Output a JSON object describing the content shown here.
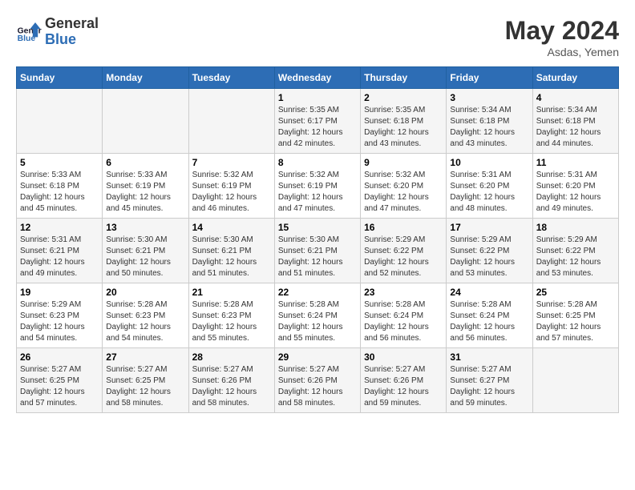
{
  "header": {
    "logo_line1": "General",
    "logo_line2": "Blue",
    "month_year": "May 2024",
    "location": "Asdas, Yemen"
  },
  "weekdays": [
    "Sunday",
    "Monday",
    "Tuesday",
    "Wednesday",
    "Thursday",
    "Friday",
    "Saturday"
  ],
  "weeks": [
    [
      {
        "day": "",
        "info": ""
      },
      {
        "day": "",
        "info": ""
      },
      {
        "day": "",
        "info": ""
      },
      {
        "day": "1",
        "info": "Sunrise: 5:35 AM\nSunset: 6:17 PM\nDaylight: 12 hours\nand 42 minutes."
      },
      {
        "day": "2",
        "info": "Sunrise: 5:35 AM\nSunset: 6:18 PM\nDaylight: 12 hours\nand 43 minutes."
      },
      {
        "day": "3",
        "info": "Sunrise: 5:34 AM\nSunset: 6:18 PM\nDaylight: 12 hours\nand 43 minutes."
      },
      {
        "day": "4",
        "info": "Sunrise: 5:34 AM\nSunset: 6:18 PM\nDaylight: 12 hours\nand 44 minutes."
      }
    ],
    [
      {
        "day": "5",
        "info": "Sunrise: 5:33 AM\nSunset: 6:18 PM\nDaylight: 12 hours\nand 45 minutes."
      },
      {
        "day": "6",
        "info": "Sunrise: 5:33 AM\nSunset: 6:19 PM\nDaylight: 12 hours\nand 45 minutes."
      },
      {
        "day": "7",
        "info": "Sunrise: 5:32 AM\nSunset: 6:19 PM\nDaylight: 12 hours\nand 46 minutes."
      },
      {
        "day": "8",
        "info": "Sunrise: 5:32 AM\nSunset: 6:19 PM\nDaylight: 12 hours\nand 47 minutes."
      },
      {
        "day": "9",
        "info": "Sunrise: 5:32 AM\nSunset: 6:20 PM\nDaylight: 12 hours\nand 47 minutes."
      },
      {
        "day": "10",
        "info": "Sunrise: 5:31 AM\nSunset: 6:20 PM\nDaylight: 12 hours\nand 48 minutes."
      },
      {
        "day": "11",
        "info": "Sunrise: 5:31 AM\nSunset: 6:20 PM\nDaylight: 12 hours\nand 49 minutes."
      }
    ],
    [
      {
        "day": "12",
        "info": "Sunrise: 5:31 AM\nSunset: 6:21 PM\nDaylight: 12 hours\nand 49 minutes."
      },
      {
        "day": "13",
        "info": "Sunrise: 5:30 AM\nSunset: 6:21 PM\nDaylight: 12 hours\nand 50 minutes."
      },
      {
        "day": "14",
        "info": "Sunrise: 5:30 AM\nSunset: 6:21 PM\nDaylight: 12 hours\nand 51 minutes."
      },
      {
        "day": "15",
        "info": "Sunrise: 5:30 AM\nSunset: 6:21 PM\nDaylight: 12 hours\nand 51 minutes."
      },
      {
        "day": "16",
        "info": "Sunrise: 5:29 AM\nSunset: 6:22 PM\nDaylight: 12 hours\nand 52 minutes."
      },
      {
        "day": "17",
        "info": "Sunrise: 5:29 AM\nSunset: 6:22 PM\nDaylight: 12 hours\nand 53 minutes."
      },
      {
        "day": "18",
        "info": "Sunrise: 5:29 AM\nSunset: 6:22 PM\nDaylight: 12 hours\nand 53 minutes."
      }
    ],
    [
      {
        "day": "19",
        "info": "Sunrise: 5:29 AM\nSunset: 6:23 PM\nDaylight: 12 hours\nand 54 minutes."
      },
      {
        "day": "20",
        "info": "Sunrise: 5:28 AM\nSunset: 6:23 PM\nDaylight: 12 hours\nand 54 minutes."
      },
      {
        "day": "21",
        "info": "Sunrise: 5:28 AM\nSunset: 6:23 PM\nDaylight: 12 hours\nand 55 minutes."
      },
      {
        "day": "22",
        "info": "Sunrise: 5:28 AM\nSunset: 6:24 PM\nDaylight: 12 hours\nand 55 minutes."
      },
      {
        "day": "23",
        "info": "Sunrise: 5:28 AM\nSunset: 6:24 PM\nDaylight: 12 hours\nand 56 minutes."
      },
      {
        "day": "24",
        "info": "Sunrise: 5:28 AM\nSunset: 6:24 PM\nDaylight: 12 hours\nand 56 minutes."
      },
      {
        "day": "25",
        "info": "Sunrise: 5:28 AM\nSunset: 6:25 PM\nDaylight: 12 hours\nand 57 minutes."
      }
    ],
    [
      {
        "day": "26",
        "info": "Sunrise: 5:27 AM\nSunset: 6:25 PM\nDaylight: 12 hours\nand 57 minutes."
      },
      {
        "day": "27",
        "info": "Sunrise: 5:27 AM\nSunset: 6:25 PM\nDaylight: 12 hours\nand 58 minutes."
      },
      {
        "day": "28",
        "info": "Sunrise: 5:27 AM\nSunset: 6:26 PM\nDaylight: 12 hours\nand 58 minutes."
      },
      {
        "day": "29",
        "info": "Sunrise: 5:27 AM\nSunset: 6:26 PM\nDaylight: 12 hours\nand 58 minutes."
      },
      {
        "day": "30",
        "info": "Sunrise: 5:27 AM\nSunset: 6:26 PM\nDaylight: 12 hours\nand 59 minutes."
      },
      {
        "day": "31",
        "info": "Sunrise: 5:27 AM\nSunset: 6:27 PM\nDaylight: 12 hours\nand 59 minutes."
      },
      {
        "day": "",
        "info": ""
      }
    ]
  ]
}
